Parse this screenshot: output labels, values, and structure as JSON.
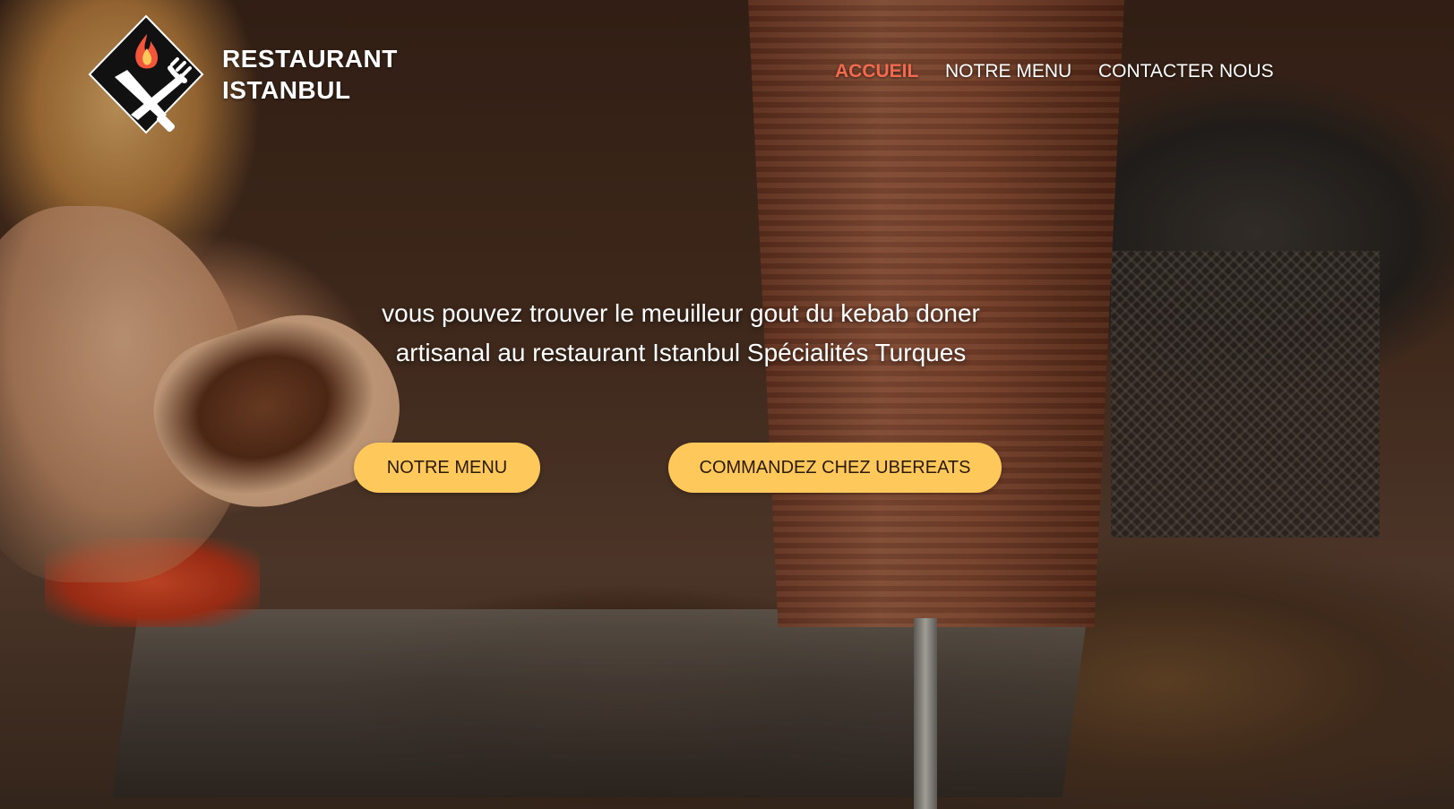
{
  "brand": {
    "line1": "RESTAURANT",
    "line2": "ISTANBUL",
    "logo_icon": "crossed-knife-fork-flame-icon"
  },
  "nav": {
    "items": [
      {
        "label": "ACCUEIL",
        "active": true
      },
      {
        "label": "NOTRE MENU",
        "active": false
      },
      {
        "label": "CONTACTER NOUS",
        "active": false
      }
    ]
  },
  "hero": {
    "tagline": "vous pouvez trouver le meuilleur gout du kebab doner artisanal au restaurant Istanbul Spécialités Turques",
    "buttons": {
      "menu": "NOTRE MENU",
      "ubereats": "COMMANDEZ CHEZ UBEREATS"
    }
  },
  "colors": {
    "accent": "#f36a4f",
    "button": "#ffc85a",
    "text": "#ffffff"
  }
}
